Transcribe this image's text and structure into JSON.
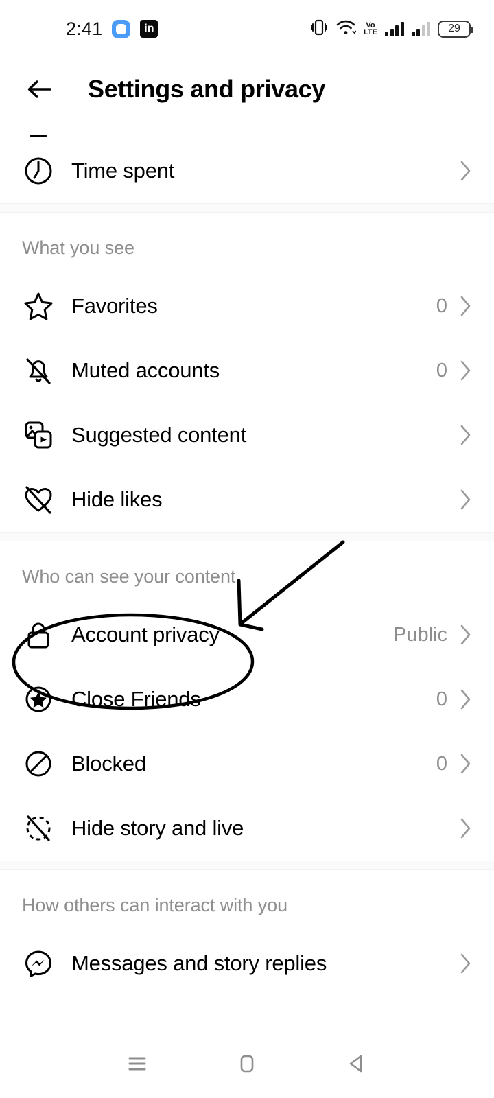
{
  "status_bar": {
    "time": "2:41",
    "left_icons": [
      "messages-app-icon",
      "linkedin-icon"
    ],
    "volte_top": "Vo",
    "volte_bottom": "LTE",
    "battery_percent": "29",
    "right_icons": [
      "vibrate-icon",
      "wifi-icon",
      "volte-icon",
      "signal-bars-sim1",
      "signal-bars-sim2",
      "battery-icon"
    ]
  },
  "header": {
    "back_label": "back-arrow",
    "title": "Settings and privacy"
  },
  "list": {
    "partial_top_item": "",
    "groups": [
      {
        "title": "",
        "items": [
          {
            "icon": "clock-icon",
            "label": "Time spent",
            "value": "",
            "chevron": true
          }
        ]
      },
      {
        "title": "What you see",
        "items": [
          {
            "icon": "star-outline-icon",
            "label": "Favorites",
            "value": "0",
            "chevron": true
          },
          {
            "icon": "bell-muted-icon",
            "label": "Muted accounts",
            "value": "0",
            "chevron": true
          },
          {
            "icon": "suggested-content-icon",
            "label": "Suggested content",
            "value": "",
            "chevron": true
          },
          {
            "icon": "heart-slash-icon",
            "label": "Hide likes",
            "value": "",
            "chevron": true
          }
        ]
      },
      {
        "title": "Who can see your content",
        "items": [
          {
            "icon": "lock-icon",
            "label": "Account privacy",
            "value": "Public",
            "chevron": true,
            "highlighted": true
          },
          {
            "icon": "star-circle-icon",
            "label": "Close Friends",
            "value": "0",
            "chevron": true
          },
          {
            "icon": "blocked-icon",
            "label": "Blocked",
            "value": "0",
            "chevron": true
          },
          {
            "icon": "story-hide-icon",
            "label": "Hide story and live",
            "value": "",
            "chevron": true
          }
        ]
      },
      {
        "title": "How others can interact with you",
        "items": [
          {
            "icon": "messenger-icon",
            "label": "Messages and story replies",
            "value": "",
            "chevron": true
          }
        ]
      }
    ]
  },
  "annotation": {
    "type": "handdrawn-ellipse-and-arrow",
    "target": "Account privacy",
    "color": "#000000"
  },
  "nav_bar": {
    "buttons": [
      "recents-button",
      "home-button",
      "back-button"
    ]
  },
  "colors": {
    "text_primary": "#000000",
    "text_secondary": "#8e8e8e",
    "background": "#ffffff",
    "divider": "#fafafa",
    "accent_blue": "#4a9cf6"
  }
}
